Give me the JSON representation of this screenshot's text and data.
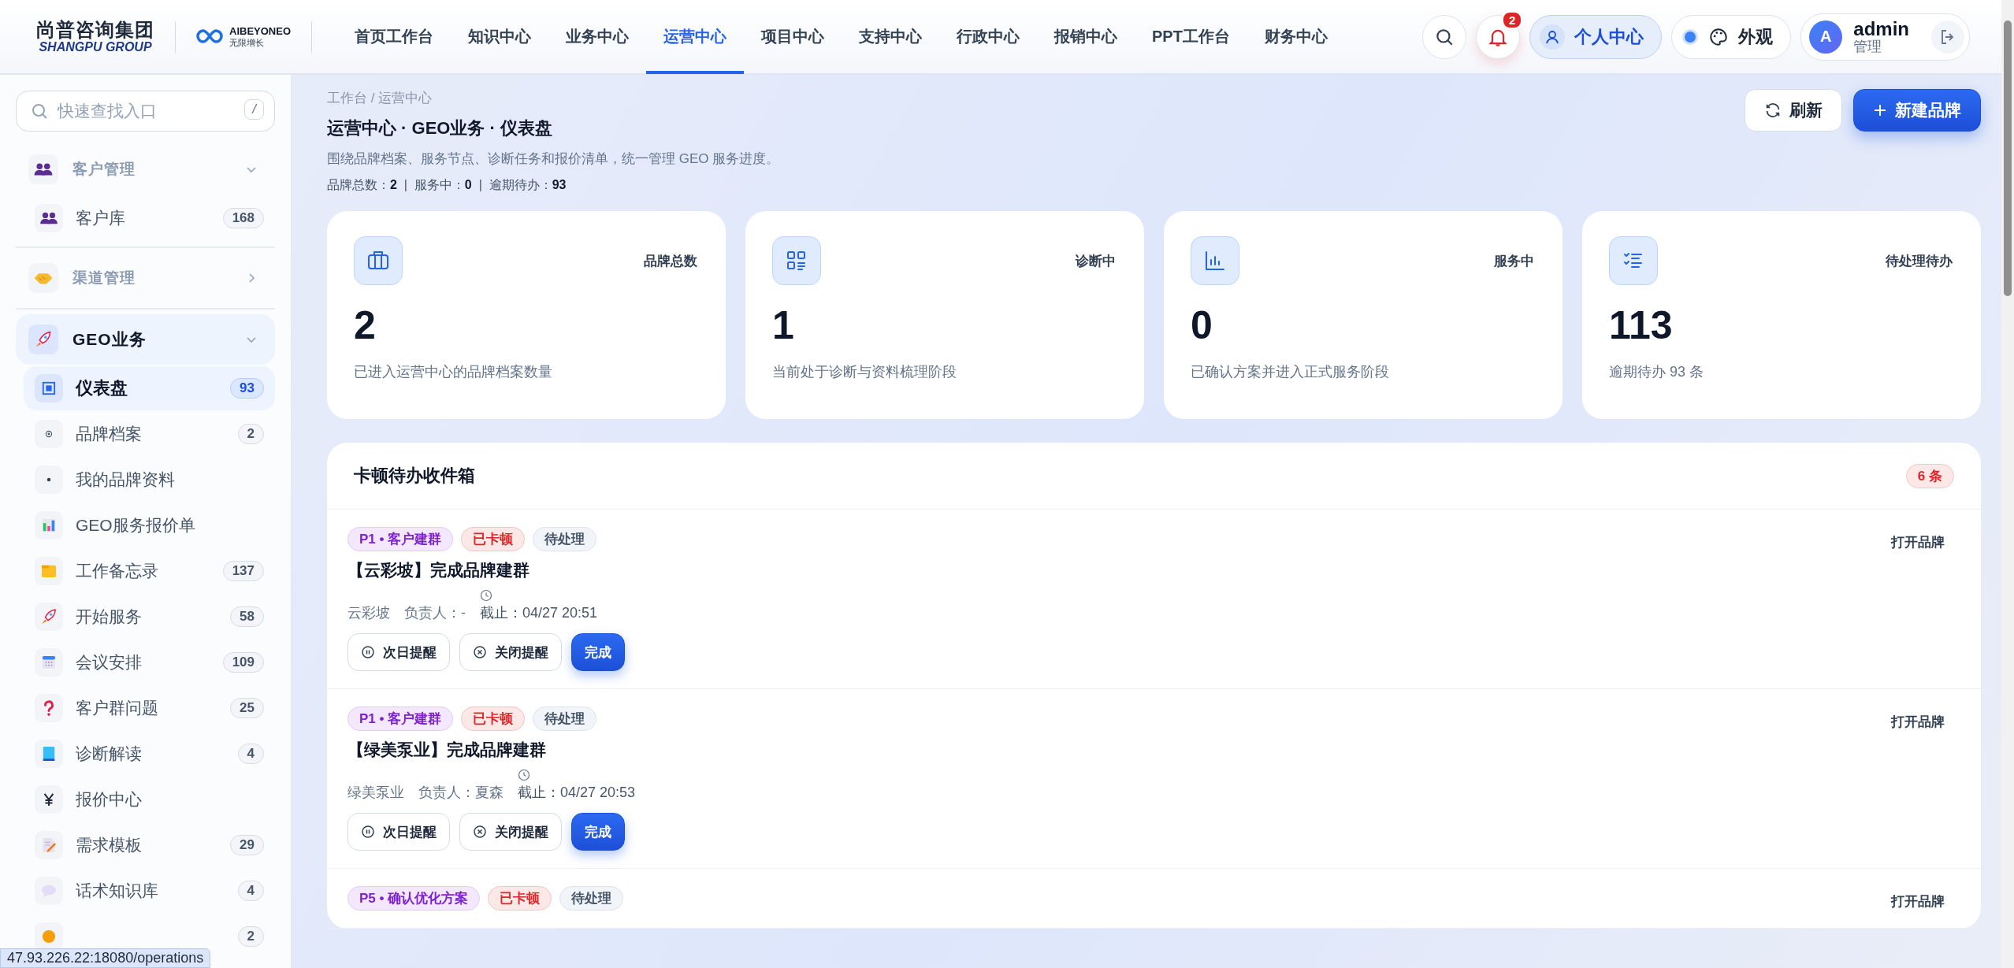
{
  "header": {
    "logo": {
      "title": "尚普咨询集团",
      "subtitle": "SHANGPU GROUP"
    },
    "partner_logo": {
      "title": "AIBEYONEO",
      "subtitle": "无限增长"
    },
    "nav": [
      {
        "label": "首页工作台",
        "selected": false
      },
      {
        "label": "知识中心",
        "selected": false
      },
      {
        "label": "业务中心",
        "selected": false
      },
      {
        "label": "运营中心",
        "selected": true
      },
      {
        "label": "项目中心",
        "selected": false
      },
      {
        "label": "支持中心",
        "selected": false
      },
      {
        "label": "行政中心",
        "selected": false
      },
      {
        "label": "报销中心",
        "selected": false
      },
      {
        "label": "PPT工作台",
        "selected": false
      },
      {
        "label": "财务中心",
        "selected": false
      }
    ],
    "notification_count": "2",
    "profile_button": "个人中心",
    "appearance_button": "外观",
    "user": {
      "initial": "A",
      "name": "admin",
      "role": "管理"
    }
  },
  "sidebar": {
    "search": {
      "placeholder": "快速查找入口",
      "shortcut": "/"
    },
    "groups": [
      {
        "label": "客户管理",
        "expanded": true,
        "active": false,
        "items": [
          {
            "label": "客户库",
            "count": "168",
            "selected": false
          }
        ]
      },
      {
        "label": "渠道管理",
        "expanded": false,
        "active": false
      },
      {
        "label": "GEO业务",
        "expanded": true,
        "active": true,
        "items": [
          {
            "label": "仪表盘",
            "count": "93",
            "selected": true
          },
          {
            "label": "品牌档案",
            "count": "2",
            "selected": false
          },
          {
            "label": "我的品牌资料",
            "selected": false
          },
          {
            "label": "GEO服务报价单",
            "selected": false
          },
          {
            "label": "工作备忘录",
            "count": "137",
            "selected": false
          },
          {
            "label": "开始服务",
            "count": "58",
            "selected": false
          },
          {
            "label": "会议安排",
            "count": "109",
            "selected": false
          },
          {
            "label": "客户群问题",
            "count": "25",
            "selected": false
          },
          {
            "label": "诊断解读",
            "count": "4",
            "selected": false
          },
          {
            "label": "报价中心",
            "selected": false
          },
          {
            "label": "需求模板",
            "count": "29",
            "selected": false
          },
          {
            "label": "话术知识库",
            "count": "4",
            "selected": false
          },
          {
            "count": "2",
            "selected": false
          }
        ]
      }
    ]
  },
  "page": {
    "breadcrumb": "工作台 / 运营中心",
    "title": "运营中心 · GEO业务 · 仪表盘",
    "description": "围绕品牌档案、服务节点、诊断任务和报价清单，统一管理 GEO 服务进度。",
    "summary": "品牌总数：**2**  |  服务中：**0**  |  逾期待办：**93**",
    "buttons": [
      {
        "label": "刷新",
        "kind": "refresh"
      },
      {
        "label": "新建品牌",
        "kind": "create"
      }
    ]
  },
  "cards": [
    {
      "label": "品牌总数",
      "value": "2",
      "note": "已进入运营中心的品牌档案数量"
    },
    {
      "label": "诊断中",
      "value": "1",
      "note": "当前处于诊断与资料梳理阶段"
    },
    {
      "label": "服务中",
      "value": "0",
      "note": "已确认方案并进入正式服务阶段"
    },
    {
      "label": "待处理待办",
      "value": "113",
      "note": "逾期待办 93 条"
    }
  ],
  "inbox": {
    "title": "卡顿待办收件箱",
    "count": "6 条",
    "items": [
      {
        "tags": [
          {
            "text": "P1 • 客户建群",
            "kind": "priority"
          },
          {
            "text": "已卡顿",
            "kind": "blocked"
          },
          {
            "text": "待处理",
            "kind": "pending"
          }
        ],
        "title": "【云彩坡】完成品牌建群",
        "brand": "云彩坡",
        "owner": "负责人：-",
        "deadline": "截止：04/27 20:51",
        "actions": [
          {
            "label": "次日提醒",
            "kind": "snooze"
          },
          {
            "label": "关闭提醒",
            "kind": "dismiss"
          },
          {
            "label": "完成",
            "kind": "done"
          }
        ],
        "link": "打开品牌"
      },
      {
        "tags": [
          {
            "text": "P1 • 客户建群",
            "kind": "priority"
          },
          {
            "text": "已卡顿",
            "kind": "blocked"
          },
          {
            "text": "待处理",
            "kind": "pending"
          }
        ],
        "title": "【绿美泵业】完成品牌建群",
        "brand": "绿美泵业",
        "owner": "负责人：夏森",
        "deadline": "截止：04/27 20:53",
        "actions": [
          {
            "label": "次日提醒",
            "kind": "snooze"
          },
          {
            "label": "关闭提醒",
            "kind": "dismiss"
          },
          {
            "label": "完成",
            "kind": "done"
          }
        ],
        "link": "打开品牌"
      },
      {
        "tags": [
          {
            "text": "P5 • 确认优化方案",
            "kind": "priority"
          },
          {
            "text": "已卡顿",
            "kind": "blocked"
          },
          {
            "text": "待处理",
            "kind": "pending"
          }
        ],
        "link": "打开品牌"
      }
    ]
  },
  "status_url": "47.93.226.22:18080/operations"
}
